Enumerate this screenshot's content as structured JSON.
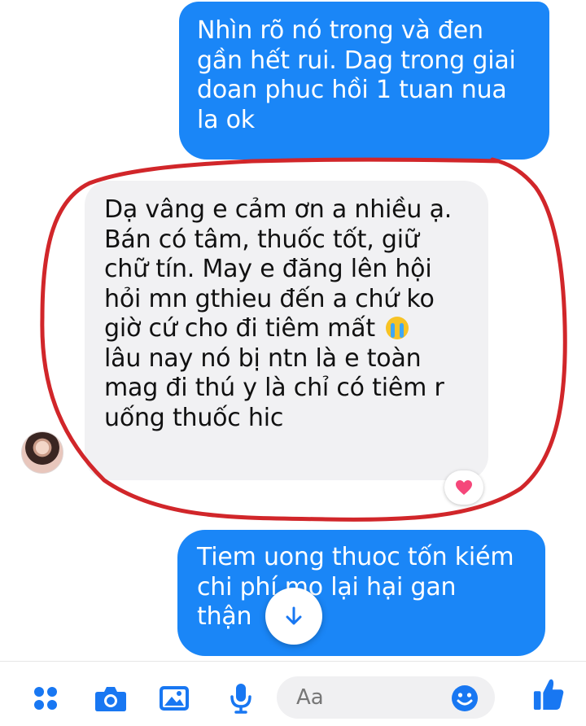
{
  "messages": [
    {
      "id": "m1",
      "direction": "outgoing",
      "text": "Nhìn rõ nó trong và đen\ngần hết rui. Dag trong giai\ndoan phuc hồi 1 tuan nua\nla ok"
    },
    {
      "id": "m2",
      "direction": "incoming",
      "text_before_emoji": "Dạ vâng e cảm ơn a nhiều ạ.\nBán có tâm, thuốc tốt, giữ\nchữ tín. May e đăng lên hội\nhỏi mn gthieu đến a chứ ko\ngiờ cứ cho đi tiêm mất",
      "text_after_emoji": "\nlâu nay nó bị ntn là e toàn\nmag đi thú y là chỉ có tiêm r\nuống thuốc hic",
      "emoji": "crying-face-icon",
      "reaction": "heart-icon"
    },
    {
      "id": "m3",
      "direction": "outgoing",
      "text": "Tiem uong thuoc tốn kiém\nchi phí mo lại hại gan\nthận"
    }
  ],
  "composer": {
    "placeholder": "Aa",
    "icons": [
      "menu-dots-icon",
      "camera-icon",
      "image-icon",
      "microphone-icon",
      "emoji-icon",
      "thumbs-up-icon"
    ]
  },
  "colors": {
    "outgoing_bubble": "#1a86f7",
    "incoming_bubble": "#f1f1f3",
    "accent": "#1877f2",
    "annotation_circle": "#d1262a",
    "heart": "#f5477a"
  }
}
